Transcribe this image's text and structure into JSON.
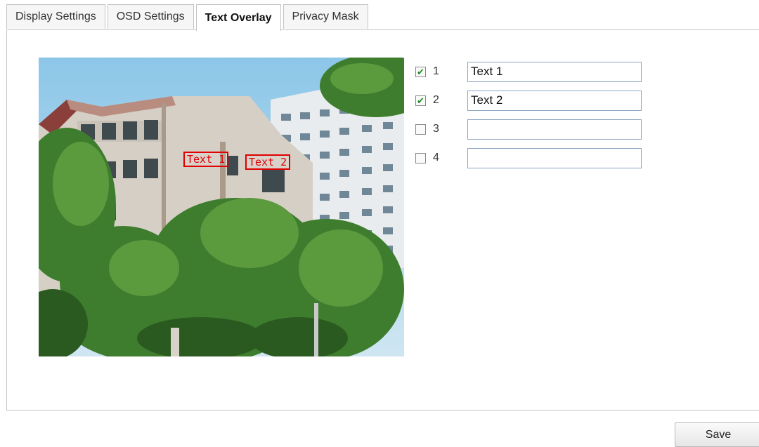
{
  "tabs": [
    {
      "label": "Display Settings",
      "active": false
    },
    {
      "label": "OSD Settings",
      "active": false
    },
    {
      "label": "Text Overlay",
      "active": true
    },
    {
      "label": "Privacy Mask",
      "active": false
    }
  ],
  "preview": {
    "overlays": [
      "Text 1",
      "Text 2"
    ],
    "overlay_color": "#e00000"
  },
  "text_rows": [
    {
      "number": "1",
      "checked": true,
      "value": "Text 1"
    },
    {
      "number": "2",
      "checked": true,
      "value": "Text 2"
    },
    {
      "number": "3",
      "checked": false,
      "value": ""
    },
    {
      "number": "4",
      "checked": false,
      "value": ""
    }
  ],
  "save_label": "Save",
  "colors": {
    "accent_border": "#8ba6c4",
    "check": "#1f8a1f"
  }
}
